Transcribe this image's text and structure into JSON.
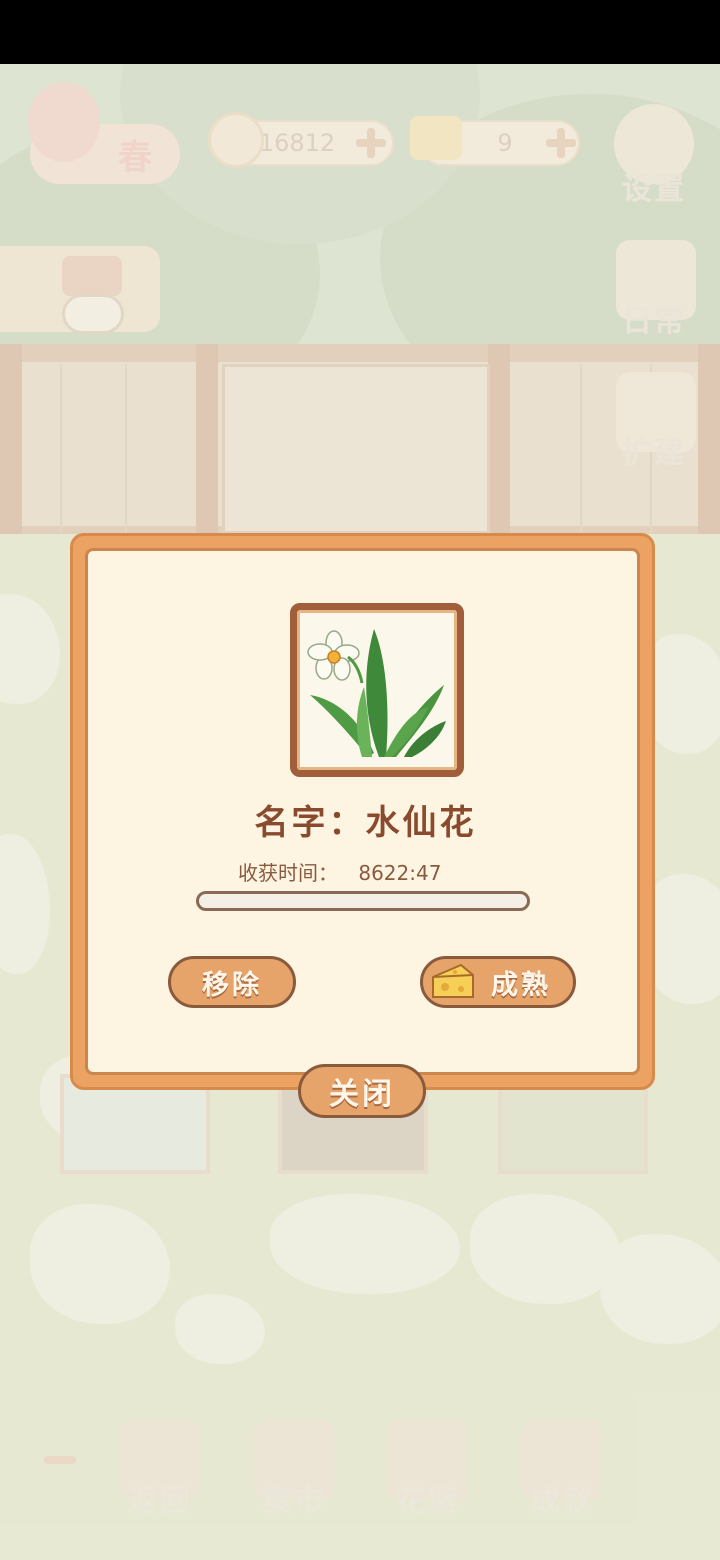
{
  "hud": {
    "season": "春",
    "fish_count": "16812",
    "cheese_count": "9",
    "settings_label": "设置",
    "daily_label": "日常",
    "expand_label": "扩建"
  },
  "bottom_nav": [
    {
      "label": "返回",
      "icon": "window-icon"
    },
    {
      "label": "集市",
      "icon": "market-stall-icon"
    },
    {
      "label": "花篮",
      "icon": "flower-basket-icon"
    },
    {
      "label": "成就",
      "icon": "trophy-icon"
    }
  ],
  "dialog": {
    "name_text": "名字：水仙花",
    "harvest_label": "收获时间：",
    "harvest_time": "8622:47",
    "progress_fraction": 0,
    "remove_label": "移除",
    "ripen_label": "成熟",
    "close_label": "关闭",
    "plant_icon": "narcissus-flower-icon"
  }
}
